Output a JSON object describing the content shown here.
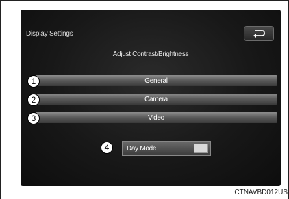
{
  "screen": {
    "title": "Display Settings",
    "back_icon": "return-arrow-icon",
    "subtitle": "Adjust Contrast/Brightness"
  },
  "menu": {
    "items": [
      {
        "callout": "1",
        "label": "General"
      },
      {
        "callout": "2",
        "label": "Camera"
      },
      {
        "callout": "3",
        "label": "Video"
      }
    ]
  },
  "day_mode": {
    "callout": "4",
    "label": "Day Mode"
  },
  "caption": "CTNAVBD012US",
  "colors": {
    "screen_bg": "#1a1a1a",
    "bar": "#6a6a6a",
    "text": "#ffffff"
  }
}
